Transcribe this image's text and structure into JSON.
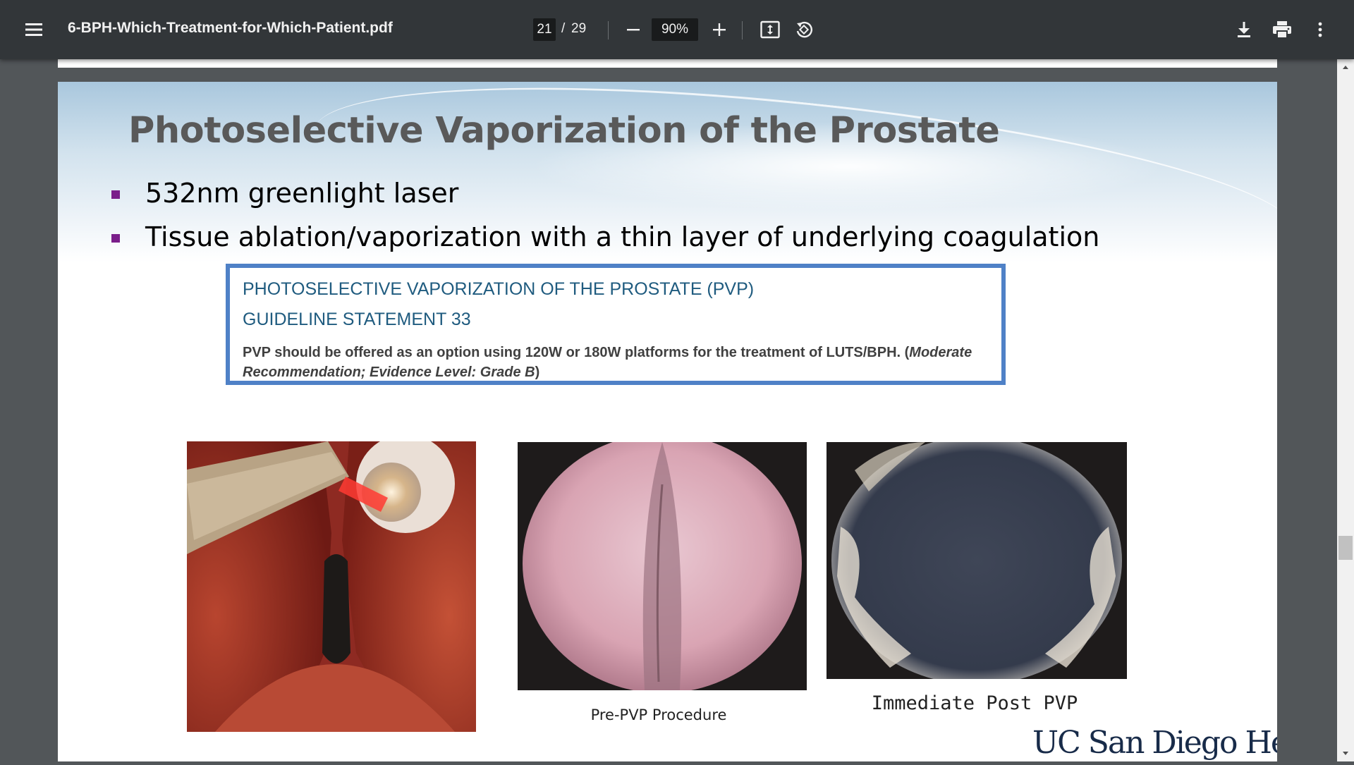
{
  "toolbar": {
    "title": "6-BPH-Which-Treatment-for-Which-Patient.pdf",
    "current_page": "21",
    "page_separator": "/",
    "total_pages": "29",
    "zoom": "90%"
  },
  "slide": {
    "title": "Photoselective Vaporization of the Prostate",
    "bullets": [
      "532nm greenlight laser",
      "Tissue ablation/vaporization with a thin layer of underlying coagulation"
    ],
    "guideline": {
      "heading": "PHOTOSELECTIVE VAPORIZATION OF THE PROSTATE (PVP)",
      "statement": "GUIDELINE STATEMENT 33",
      "body": "PVP should be offered as an option using 120W or 180W platforms for the treatment of LUTS/BPH.",
      "recommendation": "Moderate Recommendation; Evidence Level: Grade B"
    },
    "captions": {
      "pre": "Pre-PVP Procedure",
      "post": "Immediate Post PVP"
    },
    "logo": "UC San Diego Health"
  },
  "colors": {
    "toolbar_bg": "#323639",
    "viewer_bg": "#525659",
    "title_color": "#595959",
    "bullet_marker": "#7a1e8a",
    "guideline_border": "#4f81c7",
    "guideline_heading": "#1f5b7f",
    "logo_color": "#182b49"
  },
  "icons": [
    "menu-icon",
    "zoom-out-icon",
    "zoom-in-icon",
    "fit-to-page-icon",
    "rotate-icon",
    "download-icon",
    "print-icon",
    "more-options-icon",
    "scroll-up-arrow-icon",
    "scroll-down-arrow-icon"
  ]
}
